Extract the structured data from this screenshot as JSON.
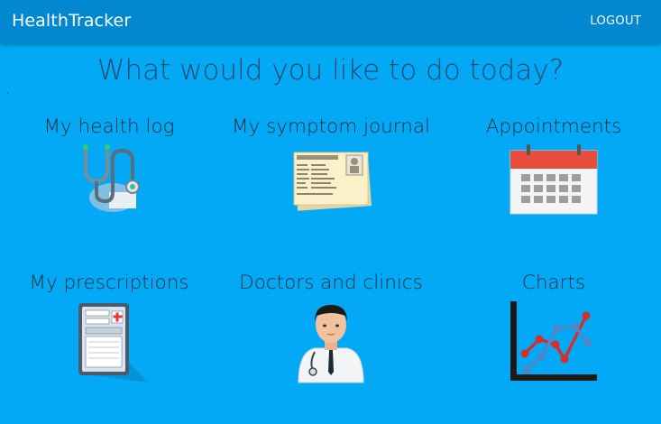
{
  "appbar": {
    "title": "HealthTracker",
    "logout_label": "LOGOUT"
  },
  "headline": "What would you like to do today?",
  "stray_mark": ",",
  "tiles": [
    {
      "label": "My health log",
      "icon": "stethoscope-icon"
    },
    {
      "label": "My symptom journal",
      "icon": "journal-card-icon"
    },
    {
      "label": "Appointments",
      "icon": "calendar-icon"
    },
    {
      "label": "My prescriptions",
      "icon": "prescription-icon"
    },
    {
      "label": "Doctors and clinics",
      "icon": "doctor-icon"
    },
    {
      "label": "Charts",
      "icon": "line-chart-icon"
    }
  ],
  "colors": {
    "background": "#03a9f4",
    "appbar": "#0288d1",
    "headline": "#1f4b73"
  }
}
